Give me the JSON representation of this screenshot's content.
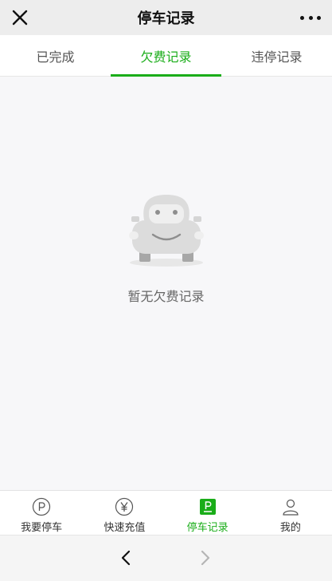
{
  "header": {
    "title": "停车记录",
    "close_icon": "close-icon",
    "more_icon": "more-dots-icon"
  },
  "tabs": [
    {
      "label": "已完成",
      "active": false
    },
    {
      "label": "欠费记录",
      "active": true
    },
    {
      "label": "违停记录",
      "active": false
    }
  ],
  "empty_state": {
    "icon": "car-smile-icon",
    "text": "暂无欠费记录"
  },
  "bottom_nav": [
    {
      "label": "我要停车",
      "icon": "parking-circle-icon",
      "active": false
    },
    {
      "label": "快速充值",
      "icon": "yuan-circle-icon",
      "active": false
    },
    {
      "label": "停车记录",
      "icon": "parking-square-icon",
      "active": true
    },
    {
      "label": "我的",
      "icon": "user-icon",
      "active": false
    }
  ],
  "browser_nav": {
    "back_icon": "chevron-left-icon",
    "forward_icon": "chevron-right-icon"
  },
  "colors": {
    "accent": "#1aad19",
    "header_bg": "#ededed",
    "page_bg": "#f7f7f9"
  }
}
